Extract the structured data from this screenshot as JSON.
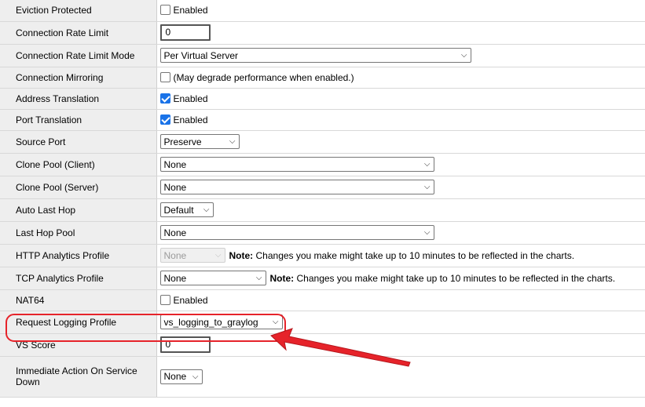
{
  "rows": [
    {
      "label": "Eviction Protected",
      "checkbox_label": "Enabled",
      "checked": false
    },
    {
      "label": "Connection Rate Limit",
      "value": "0"
    },
    {
      "label": "Connection Rate Limit Mode",
      "selected": "Per Virtual Server"
    },
    {
      "label": "Connection Mirroring",
      "checkbox_label": "(May degrade performance when enabled.)",
      "checked": false
    },
    {
      "label": "Address Translation",
      "checkbox_label": "Enabled",
      "checked": true
    },
    {
      "label": "Port Translation",
      "checkbox_label": "Enabled",
      "checked": true
    },
    {
      "label": "Source Port",
      "selected": "Preserve"
    },
    {
      "label": "Clone Pool (Client)",
      "selected": "None"
    },
    {
      "label": "Clone Pool (Server)",
      "selected": "None"
    },
    {
      "label": "Auto Last Hop",
      "selected": "Default"
    },
    {
      "label": "Last Hop Pool",
      "selected": "None"
    },
    {
      "label": "HTTP Analytics Profile",
      "selected": "None",
      "note_label": "Note:",
      "note_text": " Changes you make might take up to 10 minutes to be reflected in the charts."
    },
    {
      "label": "TCP Analytics Profile",
      "selected": "None",
      "note_label": "Note:",
      "note_text": " Changes you make might take up to 10 minutes to be reflected in the charts."
    },
    {
      "label": "NAT64",
      "checkbox_label": "Enabled",
      "checked": false
    },
    {
      "label": "Request Logging Profile",
      "selected": "vs_logging_to_graylog"
    },
    {
      "label": "VS Score",
      "value": "0"
    },
    {
      "label": "Immediate Action On Service Down",
      "selected": "None"
    }
  ],
  "colors": {
    "label_bg": "#eeeeee",
    "accent_checkbox": "#1a73e8",
    "highlight": "#e6232a"
  },
  "annotation": {
    "highlighted_row": "Request Logging Profile",
    "icon": "red-arrow-icon"
  }
}
